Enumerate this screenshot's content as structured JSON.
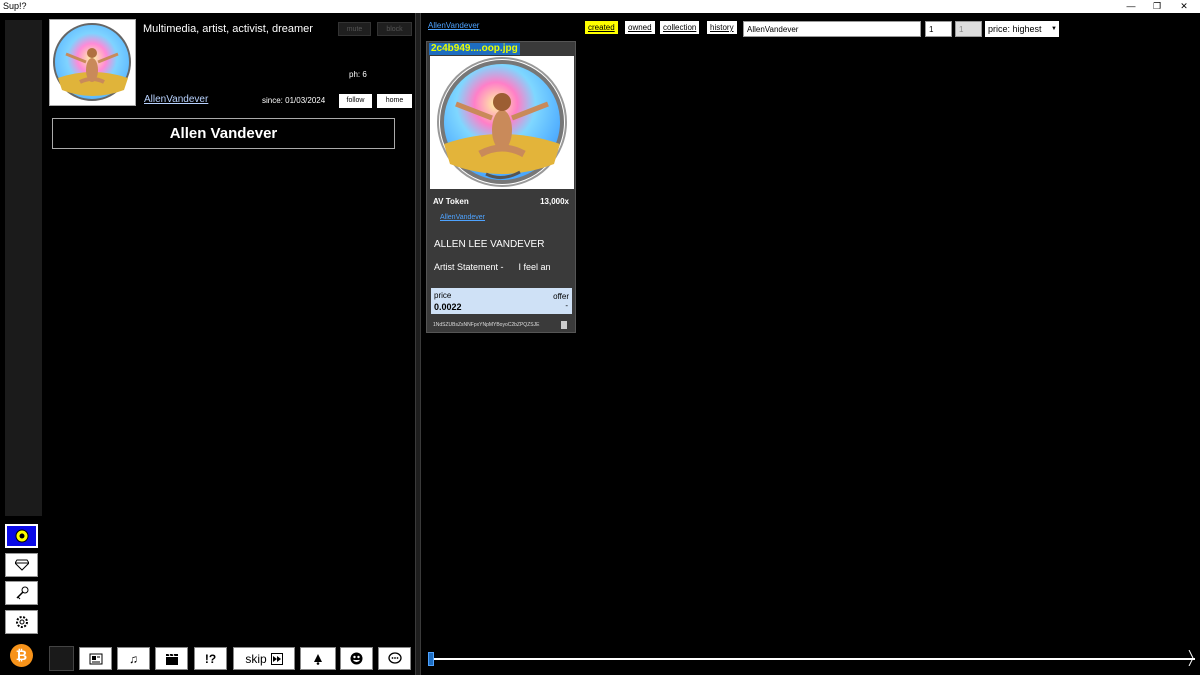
{
  "window": {
    "title": "Sup!?",
    "controls": [
      "—",
      "❐",
      "✕"
    ]
  },
  "profile": {
    "bio": "Multimedia, artist, activist, dreamer",
    "mute_label": "mute",
    "block_label": "block",
    "ph": "ph: 6",
    "username": "AllenVandever",
    "since": "since: 01/03/2024",
    "follow_label": "follow",
    "home_label": "home",
    "display_name": "Allen Vandever"
  },
  "toolbar": {
    "skip_label": "skip",
    "unknown_label": "!?"
  },
  "right": {
    "breadcrumb": "AllenVandever",
    "tabs": [
      {
        "label": "created",
        "selected": true
      },
      {
        "label": "owned",
        "selected": false
      },
      {
        "label": "collection",
        "selected": false
      },
      {
        "label": "history",
        "selected": false
      }
    ],
    "search_value": "AllenVandever",
    "qty_value": "1",
    "qty2_value": "1",
    "sort_value": "price: highest"
  },
  "card": {
    "filename": "2c4b949....oop.jpg",
    "token_name": "AV Token",
    "supply": "13,000x",
    "creator": "AllenVandever",
    "title": "ALLEN LEE VANDEVER",
    "snippet": "Artist Statement -      I feel an",
    "price_label": "price",
    "price_value": "0.0022",
    "offer_label": "offer",
    "offer_value": "-",
    "address": "1NdSZUBsZsNNFpxYNpMYBoyoC2bZPQZSJE"
  },
  "colors": {
    "accent": "#1e6dc0",
    "selected_tab": "#ffff00",
    "link": "#4ea3ff",
    "price_bg": "#cfe1f6",
    "active_rail": "#0a0ae6",
    "bitcoin": "#f7931a"
  }
}
